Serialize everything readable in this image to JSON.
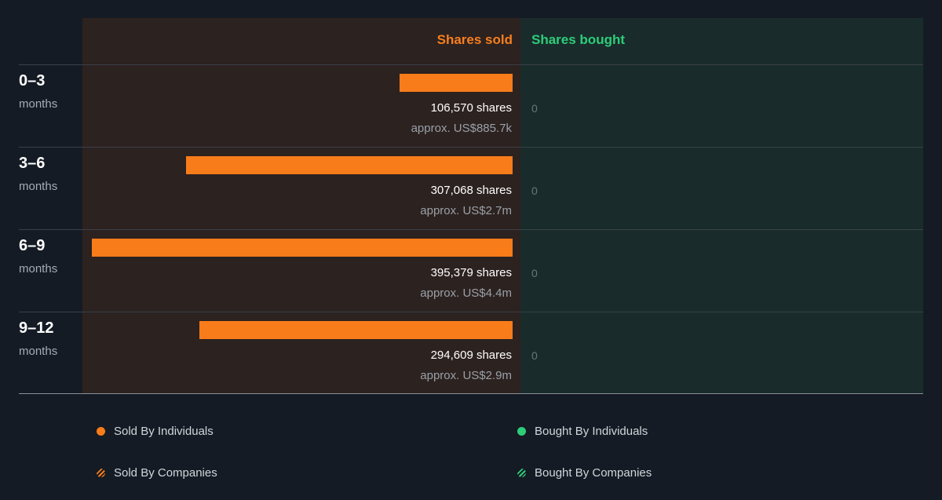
{
  "colors": {
    "sold": "#f97c1a",
    "bought": "#2dcd7a",
    "sold_panel": "#2c2220",
    "bought_panel": "#192c2b"
  },
  "headers": {
    "sold": "Shares sold",
    "bought": "Shares bought"
  },
  "chart_data": {
    "type": "bar",
    "orientation": "horizontal-diverging",
    "categories": [
      "0–3 months",
      "3–6 months",
      "6–9 months",
      "9–12 months"
    ],
    "series": [
      {
        "name": "Shares sold",
        "values": [
          106570,
          307068,
          395379,
          294609
        ]
      },
      {
        "name": "Shares bought",
        "values": [
          0,
          0,
          0,
          0
        ]
      }
    ],
    "max_value": 395379
  },
  "rows": [
    {
      "range": "0–3",
      "unit": "months",
      "shares_label": "106,570 shares",
      "approx": "approx. US$885.7k",
      "bought": "0"
    },
    {
      "range": "3–6",
      "unit": "months",
      "shares_label": "307,068 shares",
      "approx": "approx. US$2.7m",
      "bought": "0"
    },
    {
      "range": "6–9",
      "unit": "months",
      "shares_label": "395,379 shares",
      "approx": "approx. US$4.4m",
      "bought": "0"
    },
    {
      "range": "9–12",
      "unit": "months",
      "shares_label": "294,609 shares",
      "approx": "approx. US$2.9m",
      "bought": "0"
    }
  ],
  "legend": {
    "sold_individuals": "Sold By Individuals",
    "sold_companies": "Sold By Companies",
    "bought_individuals": "Bought By Individuals",
    "bought_companies": "Bought By Companies"
  }
}
